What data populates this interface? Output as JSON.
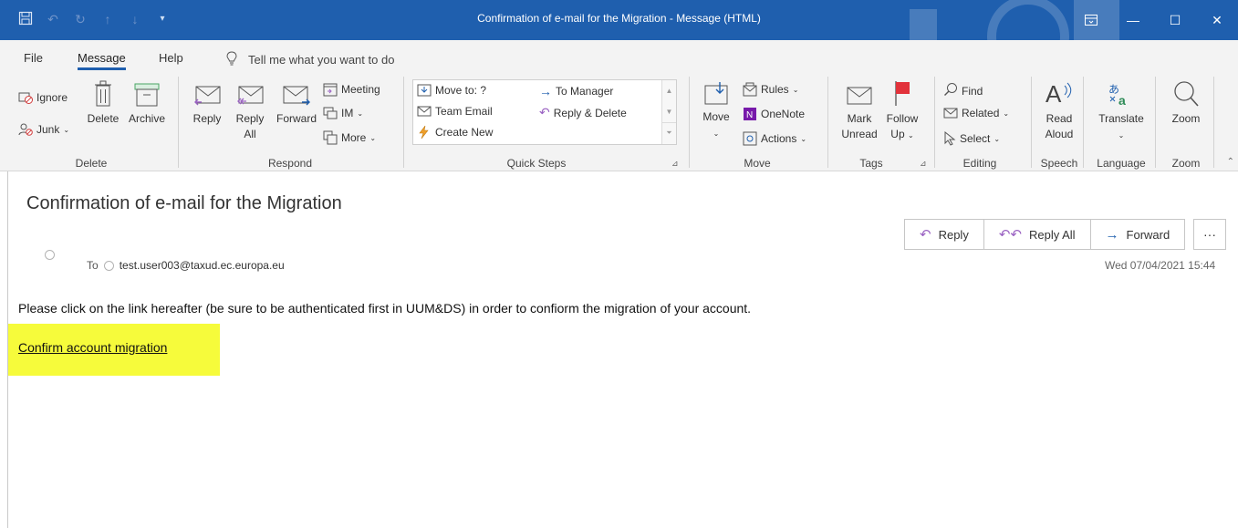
{
  "window": {
    "title": "Confirmation of e-mail for the Migration  -  Message (HTML)"
  },
  "menu": {
    "tabs": [
      "File",
      "Message",
      "Help"
    ],
    "active_tab": "Message",
    "tell_me": "Tell me what you want to do"
  },
  "ribbon": {
    "delete_group": {
      "label": "Delete",
      "ignore": "Ignore",
      "junk": "Junk",
      "delete": "Delete",
      "archive": "Archive"
    },
    "respond_group": {
      "label": "Respond",
      "reply": "Reply",
      "reply_all_1": "Reply",
      "reply_all_2": "All",
      "forward": "Forward",
      "meeting": "Meeting",
      "im": "IM",
      "more": "More"
    },
    "quick_steps_group": {
      "label": "Quick Steps",
      "move_to": "Move to: ?",
      "team_email": "Team Email",
      "create_new": "Create New",
      "to_manager": "To Manager",
      "reply_delete": "Reply & Delete"
    },
    "move_group": {
      "label": "Move",
      "move": "Move",
      "rules": "Rules",
      "onenote": "OneNote",
      "actions": "Actions"
    },
    "tags_group": {
      "label": "Tags",
      "mark_unread_1": "Mark",
      "mark_unread_2": "Unread",
      "follow_up_1": "Follow",
      "follow_up_2": "Up"
    },
    "editing_group": {
      "label": "Editing",
      "find": "Find",
      "related": "Related",
      "select": "Select"
    },
    "speech_group": {
      "label": "Speech",
      "read_aloud_1": "Read",
      "read_aloud_2": "Aloud"
    },
    "language_group": {
      "label": "Language",
      "translate": "Translate"
    },
    "zoom_group": {
      "label": "Zoom",
      "zoom": "Zoom"
    }
  },
  "message": {
    "subject": "Confirmation of e-mail for the Migration",
    "to_label": "To",
    "to_address": "test.user003@taxud.ec.europa.eu",
    "datetime": "Wed 07/04/2021 15:44",
    "actions": {
      "reply": "Reply",
      "reply_all": "Reply All",
      "forward": "Forward",
      "more": "···"
    },
    "body": "Please click on the link hereafter (be sure to be authenticated first in UUM&DS) in order to confiorm the migration of your account.",
    "link_text": "Confirm account migration",
    "highlight_color": "#f6fb3b"
  },
  "colors": {
    "titlebar": "#1f5fae",
    "ribbon": "#f3f3f3",
    "flag": "#e2323b"
  }
}
